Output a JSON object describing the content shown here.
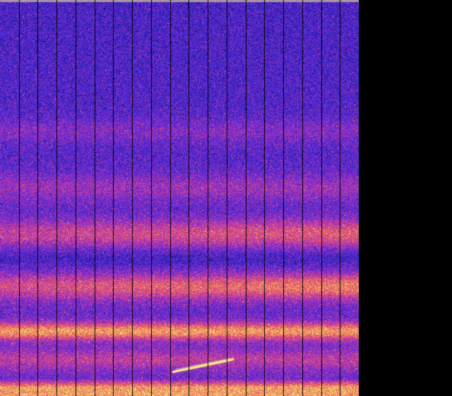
{
  "image": {
    "subject": "spectrogram-waterfall",
    "colormap": [
      "#000000",
      "#1a0f8c",
      "#3a2ad0",
      "#7a2ad0",
      "#c43aa8",
      "#e8556a",
      "#f0a050",
      "#f6ee8c"
    ],
    "background": "#000000",
    "grid_line_color": "#000000",
    "segment_count": 19,
    "features": {
      "bright_bands": [
        {
          "level": "moderate",
          "relative_position": "upper-middle"
        },
        {
          "level": "strong",
          "relative_position": "middle"
        },
        {
          "level": "strong",
          "relative_position": "lower-middle"
        },
        {
          "level": "very-strong",
          "relative_position": "bottom"
        }
      ],
      "diagonal_streak": "present",
      "noise": "speckled"
    }
  }
}
